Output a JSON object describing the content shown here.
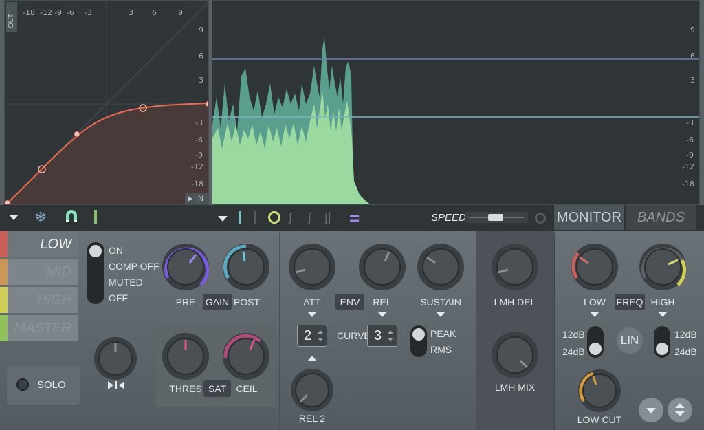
{
  "graph": {
    "out_label": "OUT",
    "in_label": "IN",
    "top_ticks": [
      "-18",
      "-12",
      "-9",
      "-6",
      "-3",
      "3",
      "6",
      "9"
    ],
    "right_ticks": [
      "9",
      "6",
      "3",
      "-3",
      "-6",
      "-9",
      "-12",
      "-18"
    ]
  },
  "meter": {
    "right_ticks": [
      "9",
      "6",
      "3",
      "-3",
      "-6",
      "-9",
      "-12",
      "-18"
    ]
  },
  "toolbar": {
    "speed_label": "SPEED",
    "monitor_tab": "MONITOR",
    "bands_tab": "BANDS"
  },
  "bands": {
    "low": "LOW",
    "mid": "MID",
    "high": "HIGH",
    "master": "MASTER",
    "colors": {
      "low": "#c9605a",
      "mid": "#c99658",
      "high": "#cfcf58",
      "master": "#8fc25a"
    }
  },
  "solo_label": "SOLO",
  "state_options": [
    "ON",
    "COMP OFF",
    "MUTED",
    "OFF"
  ],
  "gain": {
    "pre": "PRE",
    "button": "GAIN",
    "post": "POST"
  },
  "sat": {
    "thres": "THRES",
    "button": "SAT",
    "ceil": "CEIL"
  },
  "envelope": {
    "att": "ATT",
    "env_button": "ENV",
    "rel": "REL",
    "sustain": "SUSTAIN",
    "curve_label": "CURVE",
    "att_curve": "2",
    "rel_curve": "3",
    "peak": "PEAK",
    "rms": "RMS",
    "rel2": "REL 2"
  },
  "lmh": {
    "del": "LMH DEL",
    "mix": "LMH MIX"
  },
  "xover": {
    "low": "LOW",
    "freq_button": "FREQ",
    "high": "HIGH",
    "low_12": "12dB",
    "low_24": "24dB",
    "lin": "LIN",
    "high_12": "12dB",
    "high_24": "24dB",
    "low_cut": "LOW CUT"
  }
}
